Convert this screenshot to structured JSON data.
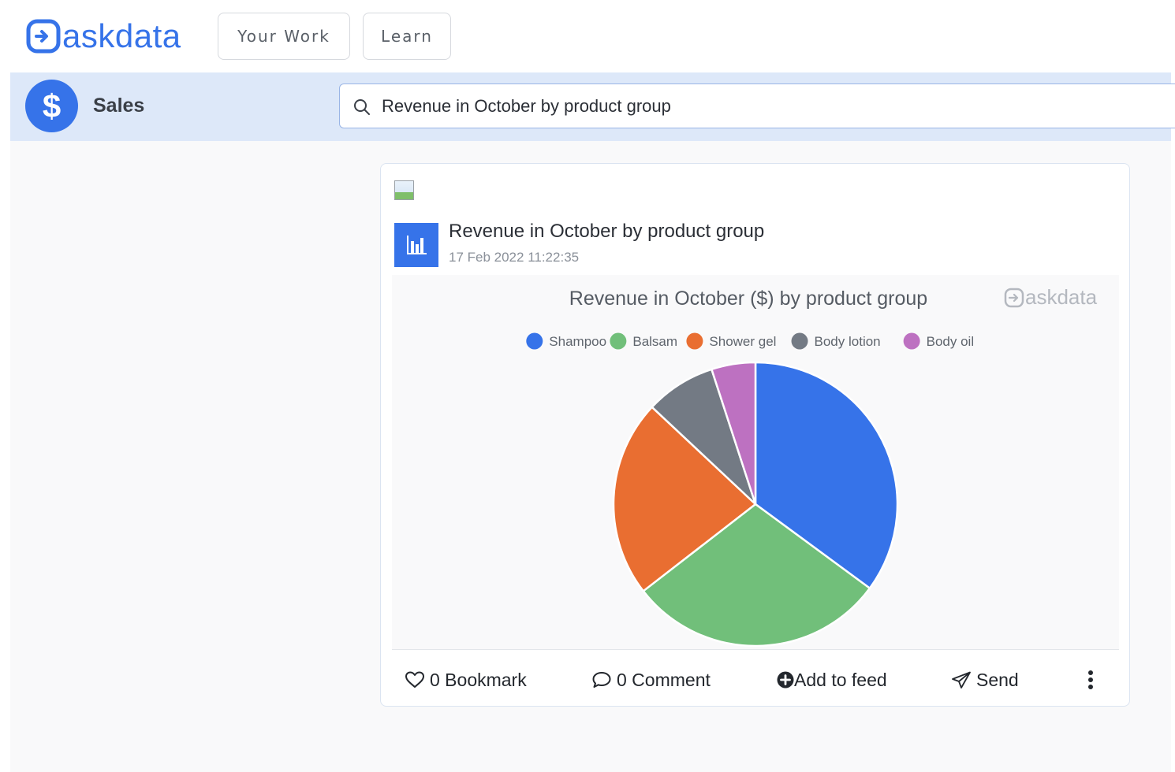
{
  "brand": {
    "name": "askdata",
    "color": "#3673e9"
  },
  "nav": {
    "your_work_label": "Your Work",
    "learn_label": "Learn"
  },
  "workspace": {
    "name": "Sales",
    "icon": "dollar-icon",
    "icon_symbol": "$"
  },
  "search": {
    "value": "Revenue in October by product group",
    "icon": "search-icon"
  },
  "card": {
    "title": "Revenue in October by product group",
    "timestamp": "17 Feb 2022 11:22:35",
    "badge_icon": "bar-chart-icon",
    "image_icon": "broken-image-icon"
  },
  "chart_data": {
    "type": "pie",
    "title": "Revenue in October ($) by product group",
    "watermark": "askdata",
    "legend_position": "top",
    "categories": [
      "Shampoo",
      "Balsam",
      "Shower gel",
      "Body lotion",
      "Body oil"
    ],
    "values": [
      35.1,
      29.4,
      22.5,
      8.0,
      5.0
    ],
    "colors": [
      "#3673e9",
      "#71bf7a",
      "#e96e31",
      "#737a84",
      "#bd71c1"
    ]
  },
  "actions": {
    "bookmark_label": "0 Bookmark",
    "comment_label": "0 Comment",
    "add_feed_label": "Add to feed",
    "send_label": "Send"
  }
}
